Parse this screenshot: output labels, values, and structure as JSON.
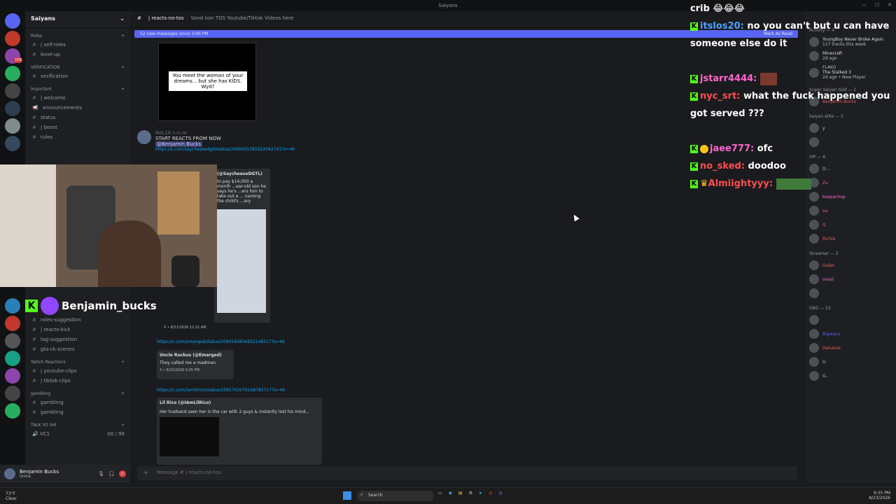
{
  "window": {
    "title": "Saiyans"
  },
  "server": {
    "name": "Saiyans"
  },
  "sidebar": {
    "categories": [
      {
        "name": "Roles",
        "channels": [
          "| self-roles",
          "level-up"
        ]
      },
      {
        "name": "VERIFICATION",
        "channels": [
          "verification"
        ]
      },
      {
        "name": "Important",
        "channels": [
          "| welcome",
          "announcements",
          "status",
          "| boost",
          "rules"
        ]
      }
    ],
    "lower_channels": [
      "roles-suggestion",
      "| reacts-kick",
      "tag-suggestion",
      "gta-ck-scenes"
    ],
    "twitch_category": "Twitch Reactions",
    "twitch_channels": [
      "| youtube-clips",
      "| tiktok-clips"
    ],
    "gambling_category": "gambling",
    "gambling_channels": [
      "gambling",
      "gambling"
    ],
    "voice_category": "TALK YO SHI",
    "voice_channels": [
      {
        "name": "VC1",
        "count": "00 / 99"
      }
    ]
  },
  "user": {
    "name": "Benjamin Bucks",
    "status": "Online"
  },
  "channel": {
    "name": "| reacts-no-tos",
    "topic": "Send non TOS Youtube/Tiktok Videos here"
  },
  "newbar": {
    "text": "52 new messages since 3:00 PM",
    "action": "Mark As Read"
  },
  "messages": {
    "meme_caption": "You meet the woman of your dreams... but she has KIDS. Wyd?",
    "author": "NeL16",
    "time": "9:15 PM",
    "text": "START REACTS FROM NOW",
    "mention": "@Benjamin Bucks",
    "link1": "https://x.com/saycheesedgtl/status/2090655381622042741?s=46",
    "embed1_author": "(@SaycheeseDGTL)",
    "embed1_text": "to pay $14,000 a month ...ear-old son he says he's ...ers him to take out a ... naming the child's ...ary",
    "embed1_footer": "X • 8/21/2026 12:21 AM",
    "link2": "https://x.com/emarged/status/2090545856852148517?s=46",
    "embed2_author": "Uncle Ruckus (@Emarged)",
    "embed2_text": "They called me a madman.",
    "embed2_footer": "X • 8/20/2026 5:05 PM",
    "link3": "https://x.com/iamlilrico/status/2091742079168782717?s=46",
    "embed3_author": "Lil Rico (@IAmLilRico)",
    "embed3_text": "Her husband seen her in the car with 2 guys & instantly lost his mind..."
  },
  "composer": {
    "placeholder": "Message # | reacts-no-tos"
  },
  "overlay": {
    "streamer_tag": "Benjamin_bucks",
    "chat": [
      {
        "user": "",
        "text": "crib 😂😂😂",
        "color": "#ffffff"
      },
      {
        "user": "itslos20:",
        "text": "no you can't but u can have someone else do it",
        "color": "#4da3ff"
      },
      {
        "user": "jstarr4444:",
        "text": "",
        "color": "#ff66cc"
      },
      {
        "user": "nyc_srt:",
        "text": "what the fuck happened you got served ???",
        "color": "#ff4d4d"
      },
      {
        "user": "jaee777:",
        "text": "ofc",
        "color": "#ff66cc"
      },
      {
        "user": "no_sked:",
        "text": "doodoo",
        "color": "#ff4d4d"
      },
      {
        "user": "Almiightyyy:",
        "text": "",
        "color": "#ff4d4d"
      }
    ]
  },
  "members": {
    "activity_label": "Activity — 4",
    "activity": [
      {
        "name": "YoungBoy Never Broke Again",
        "sub": "117 tracks this week"
      },
      {
        "name": "Minecraft",
        "sub": "2d ago"
      },
      {
        "name": "FLAKO",
        "sub": ""
      },
      {
        "name": "The Stalked 3",
        "sub": "2d ago • New Player"
      }
    ],
    "groups": [
      {
        "label": "Super Saiyan God — 1",
        "members": [
          "Benjamin Bucks"
        ]
      },
      {
        "label": "Saiyan elite — 2",
        "members": [
          "y",
          ""
        ]
      },
      {
        "label": "VIP — 6",
        "members": [
          "D...",
          "Zu",
          "keepachop",
          "aa",
          "Q",
          "Richie"
        ]
      },
      {
        "label": "Streamer — 3",
        "members": [
          "Galan",
          "onesl",
          ""
        ]
      },
      {
        "label": "GBG — 23",
        "members": [
          "",
          "Bigwavy",
          "Delusive",
          "G",
          "G..",
          ""
        ]
      }
    ]
  },
  "taskbar": {
    "weather": "73°F",
    "weather_sub": "Clear",
    "search": "Search",
    "time": "9:35 PM",
    "date": "8/23/2026"
  }
}
